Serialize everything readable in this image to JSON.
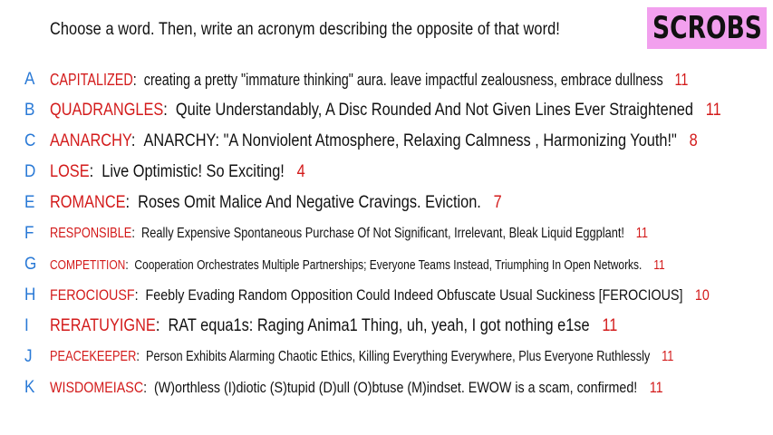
{
  "prompt": "Choose a word. Then, write an acronym describing the opposite of that word!",
  "logo_text": "SCROBS",
  "colors": {
    "letter": "#2979d6",
    "word": "#d31b1b",
    "count": "#d31b1b",
    "logo_bg": "#f2a0ee"
  },
  "entries": [
    {
      "letter": "A",
      "word": "CAPITALIZED",
      "desc": "creating a pretty \"immature thinking\" aura. leave impactful zealousness, embrace dullness",
      "count": "11"
    },
    {
      "letter": "B",
      "word": "QUADRANGLES",
      "desc": "Quite Understandably, A Disc Rounded And Not Given Lines Ever Straightened",
      "count": "11"
    },
    {
      "letter": "C",
      "word": "AANARCHY",
      "desc": "ANARCHY: \"A Nonviolent Atmosphere, Relaxing Calmness , Harmonizing Youth!\"",
      "count": "8"
    },
    {
      "letter": "D",
      "word": "LOSE",
      "desc": "Live Optimistic! So Exciting!",
      "count": "4"
    },
    {
      "letter": "E",
      "word": "ROMANCE",
      "desc": "Roses Omit Malice And Negative Cravings. Eviction.",
      "count": "7"
    },
    {
      "letter": "F",
      "word": "RESPONSIBLE",
      "desc": "Really Expensive Spontaneous Purchase Of Not Significant, Irrelevant, Bleak Liquid Eggplant!",
      "count": "11"
    },
    {
      "letter": "G",
      "word": "COMPETITION",
      "desc": "Cooperation Orchestrates Multiple Partnerships; Everyone Teams Instead, Triumphing In Open Networks.",
      "count": "11"
    },
    {
      "letter": "H",
      "word": "FEROCIOUSF",
      "desc": "Feebly Evading Random Opposition Could Indeed Obfuscate Usual Suckiness [FEROCIOUS]",
      "count": "10"
    },
    {
      "letter": "I",
      "word": "RERATUYIGNE",
      "desc": "RAT equa1s: Raging Anima1 Thing, uh, yeah, I got nothing e1se",
      "count": "11"
    },
    {
      "letter": "J",
      "word": "PEACEKEEPER",
      "desc": "Person Exhibits Alarming Chaotic Ethics, Killing Everything Everywhere, Plus Everyone Ruthlessly",
      "count": "11"
    },
    {
      "letter": "K",
      "word": "WISDOMEIASC",
      "desc": "(W)orthless (I)diotic (S)tupid (D)ull (O)btuse (M)indset. EWOW is a scam, confirmed!",
      "count": "11"
    }
  ]
}
